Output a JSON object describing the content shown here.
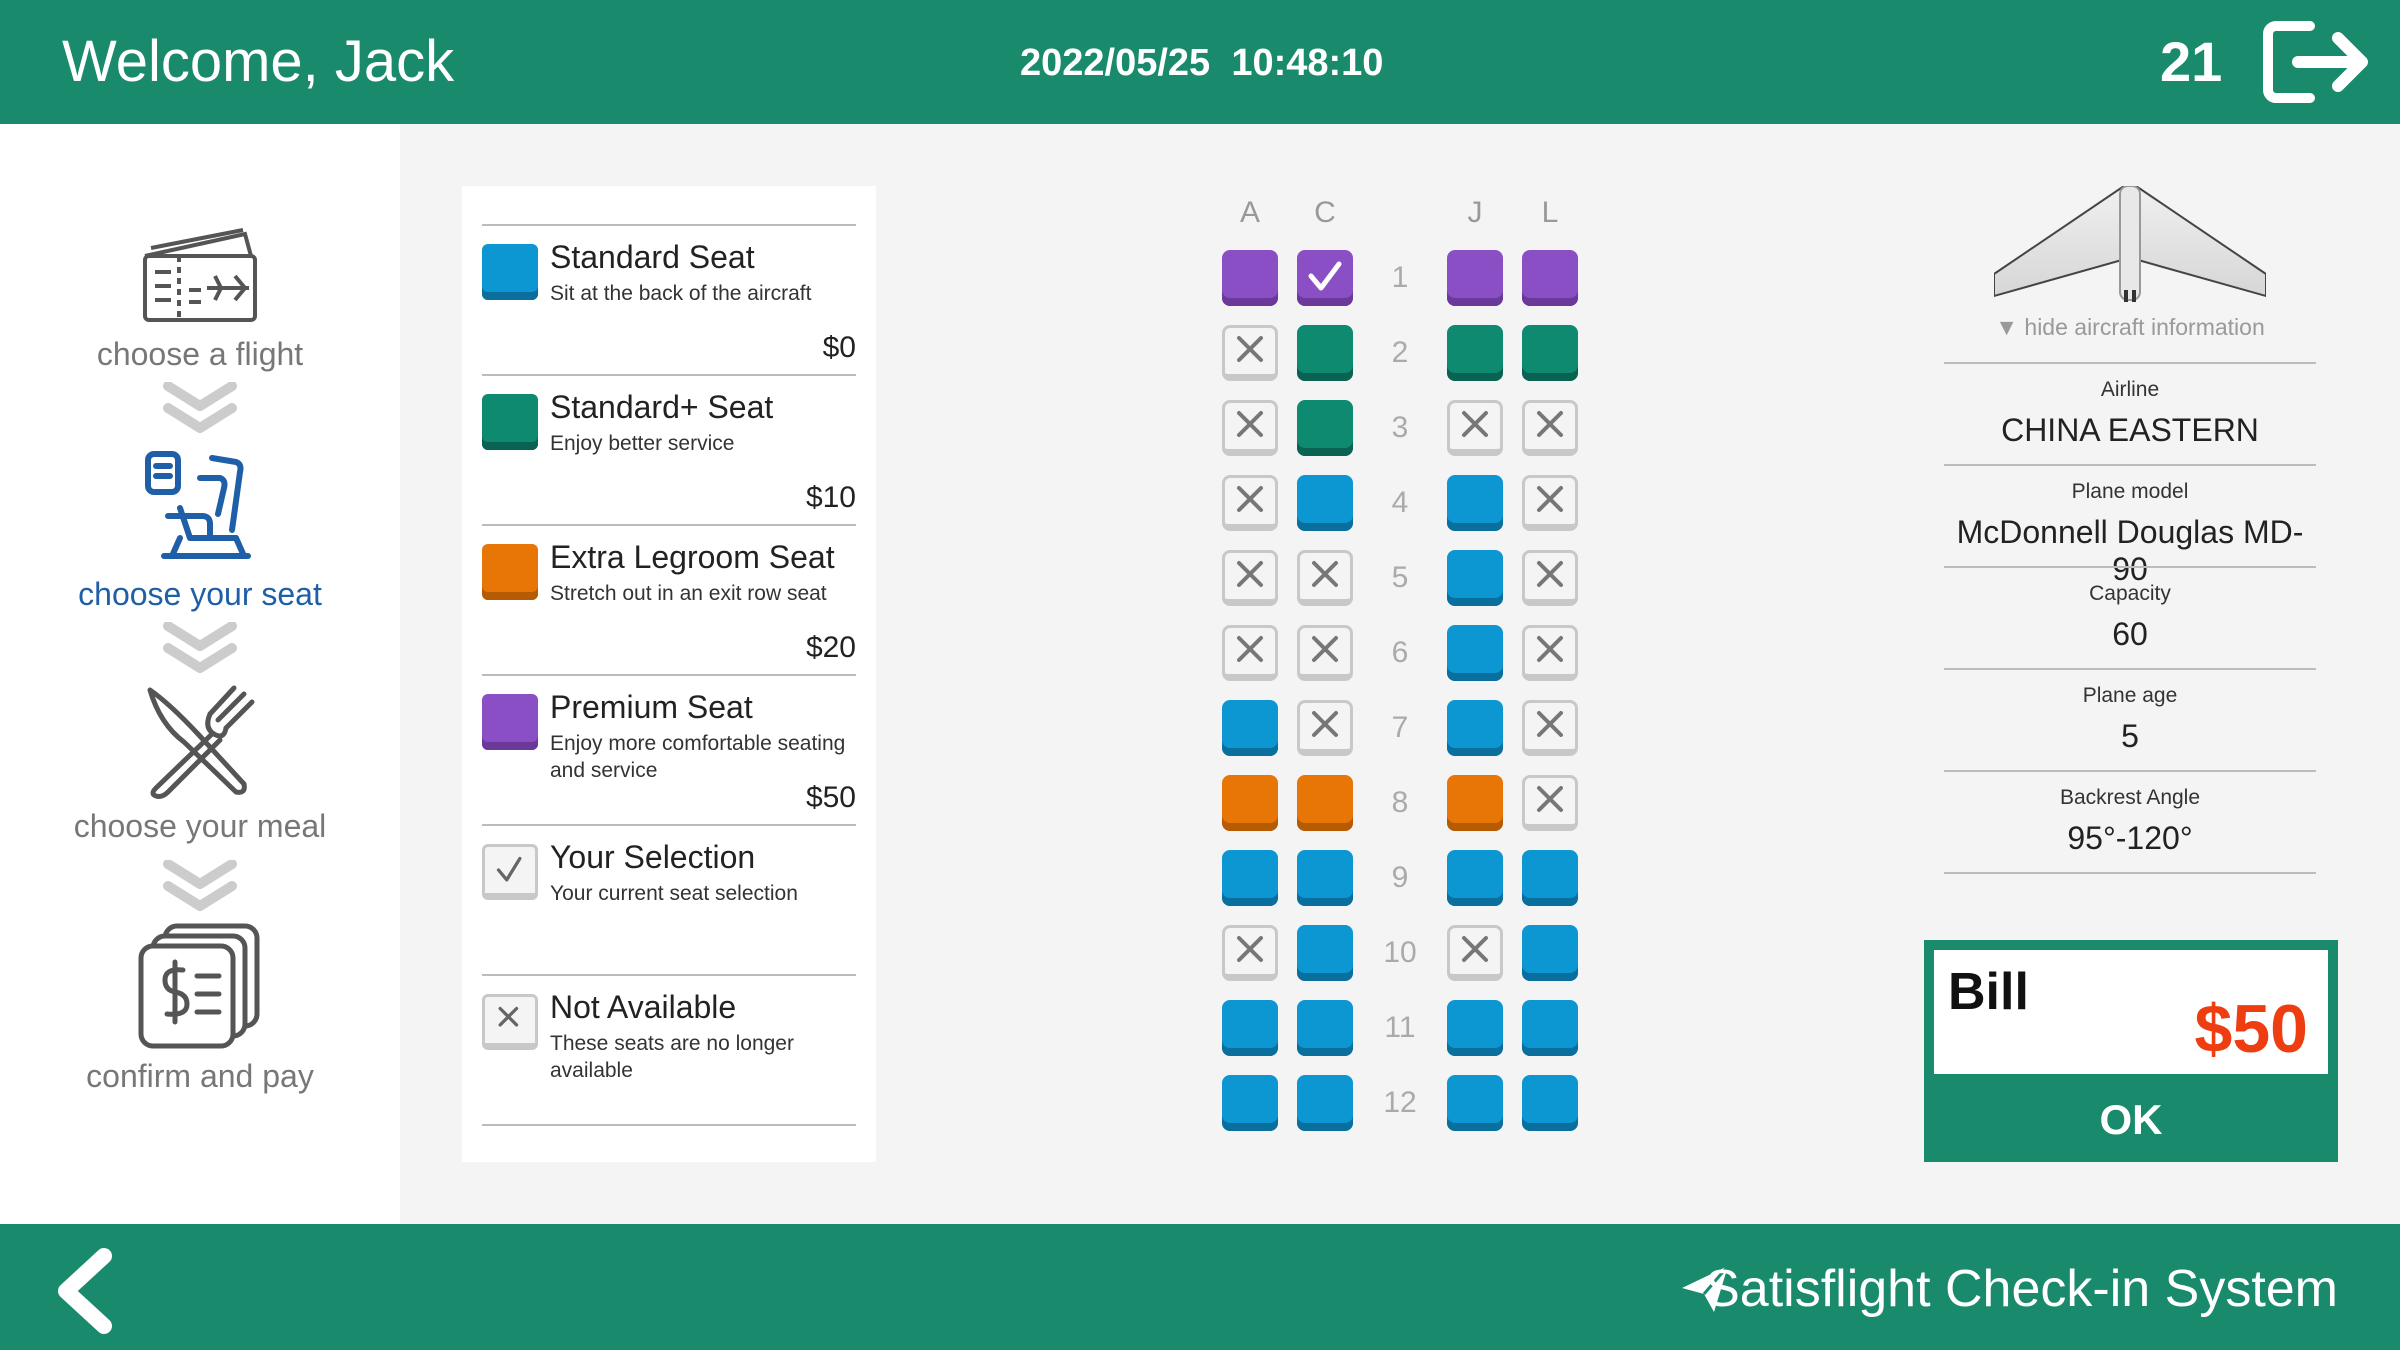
{
  "header": {
    "welcome": "Welcome, Jack",
    "date": "2022/05/25",
    "time": "10:48:10",
    "countdown": "21",
    "bg_color": "#1a8a6c"
  },
  "steps": [
    {
      "label": "choose a flight",
      "icon": "ticket-icon",
      "active": false
    },
    {
      "label": "choose your seat",
      "icon": "seat-icon",
      "active": true
    },
    {
      "label": "choose your meal",
      "icon": "meal-icon",
      "active": false
    },
    {
      "label": "confirm and pay",
      "icon": "bill-icon",
      "active": false
    }
  ],
  "legend": [
    {
      "title": "Standard Seat",
      "desc": "Sit at the back of the aircraft",
      "price": "$0",
      "color": "#0c96d2"
    },
    {
      "title": "Standard+ Seat",
      "desc": "Enjoy better service",
      "price": "$10",
      "color": "#0d8a70"
    },
    {
      "title": "Extra Legroom Seat",
      "desc": "Stretch out in an exit row seat",
      "price": "$20",
      "color": "#e77607"
    },
    {
      "title": "Premium Seat",
      "desc": "Enjoy more comfortable seating and service",
      "price": "$50",
      "color": "#8a4fc5"
    },
    {
      "title": "Your Selection",
      "desc": "Your current seat selection",
      "price": ""
    },
    {
      "title": "Not Available",
      "desc": "These seats are no longer available",
      "price": ""
    }
  ],
  "seatmap": {
    "columns": [
      "A",
      "C",
      "J",
      "L"
    ],
    "rows": [
      {
        "num": "1",
        "seats": [
          "premium",
          "selected",
          "premium",
          "premium"
        ]
      },
      {
        "num": "2",
        "seats": [
          "na",
          "standardplus",
          "standardplus",
          "standardplus"
        ]
      },
      {
        "num": "3",
        "seats": [
          "na",
          "standardplus",
          "na",
          "na"
        ]
      },
      {
        "num": "4",
        "seats": [
          "na",
          "standard",
          "standard",
          "na"
        ]
      },
      {
        "num": "5",
        "seats": [
          "na",
          "na",
          "standard",
          "na"
        ]
      },
      {
        "num": "6",
        "seats": [
          "na",
          "na",
          "standard",
          "na"
        ]
      },
      {
        "num": "7",
        "seats": [
          "standard",
          "na",
          "standard",
          "na"
        ]
      },
      {
        "num": "8",
        "seats": [
          "extra",
          "extra",
          "extra",
          "na"
        ]
      },
      {
        "num": "9",
        "seats": [
          "standard",
          "standard",
          "standard",
          "standard"
        ]
      },
      {
        "num": "10",
        "seats": [
          "na",
          "standard",
          "na",
          "standard"
        ]
      },
      {
        "num": "11",
        "seats": [
          "standard",
          "standard",
          "standard",
          "standard"
        ]
      },
      {
        "num": "12",
        "seats": [
          "standard",
          "standard",
          "standard",
          "standard"
        ]
      }
    ]
  },
  "aircraft": {
    "toggle_label": "hide aircraft information",
    "fields": [
      {
        "label": "Airline",
        "value": "CHINA EASTERN"
      },
      {
        "label": "Plane model",
        "value": "McDonnell Douglas MD-90"
      },
      {
        "label": "Capacity",
        "value": "60"
      },
      {
        "label": "Plane age",
        "value": "5"
      },
      {
        "label": "Backrest Angle",
        "value": "95°-120°"
      }
    ]
  },
  "bill": {
    "label": "Bill",
    "amount": "$50",
    "ok_label": "OK",
    "amount_color": "#ee3d10"
  },
  "footer": {
    "brand": "Satisflight Check-in System"
  }
}
